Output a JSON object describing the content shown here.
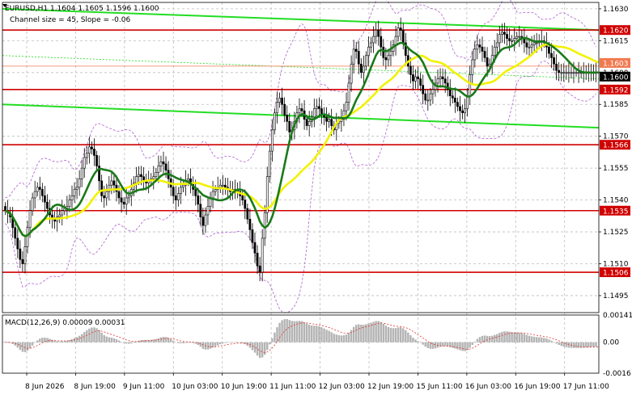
{
  "chart_data": {
    "type": "candlestick",
    "title": "EURUSD,H1  1.1604 1.1605 1.1596 1.1600",
    "subtitle": "Channel size = 45, Slope = -0.06",
    "y_ticks": [
      "1.1630",
      "1.1615",
      "1.1600",
      "1.1585",
      "1.1570",
      "1.1555",
      "1.1540",
      "1.1525",
      "1.1510",
      "1.1495"
    ],
    "ylim": [
      1.1487,
      1.1633
    ],
    "x_ticks": [
      "8 Jun 2026",
      "8 Jun 19:00",
      "9 Jun 11:00",
      "10 Jun 03:00",
      "10 Jun 19:00",
      "11 Jun 11:00",
      "12 Jun 03:00",
      "12 Jun 19:00",
      "15 Jun 11:00",
      "16 Jun 03:00",
      "16 Jun 19:00",
      "17 Jun 11:00"
    ],
    "bars_count": 240,
    "levels": [
      {
        "value": 1.162,
        "label": "1.1620",
        "color": "#d00000"
      },
      {
        "value": 1.1592,
        "label": "1.1592",
        "color": "#d00000"
      },
      {
        "value": 1.1566,
        "label": "1.1566",
        "color": "#d00000"
      },
      {
        "value": 1.1535,
        "label": "1.1535",
        "color": "#d00000"
      },
      {
        "value": 1.1506,
        "label": "1.1506",
        "color": "#d00000"
      }
    ],
    "price_labels": [
      {
        "value": 1.1603,
        "label": "1.1603",
        "color": "#f07a50"
      },
      {
        "value": 1.16,
        "label": "1.1600",
        "color": "#000000"
      }
    ],
    "channel_color": "#22dd22",
    "ma_fast_color": "#1a7a1a",
    "ma_slow_color": "#f2f200",
    "bollinger_color": "#b060d0",
    "close": [
      1.1535,
      1.1534,
      1.1532,
      1.1527,
      1.1522,
      1.1517,
      1.1512,
      1.151,
      1.1518,
      1.1527,
      1.1535,
      1.1541,
      1.1544,
      1.1546,
      1.1545,
      1.1542,
      1.1539,
      1.1536,
      1.1533,
      1.1531,
      1.153,
      1.1532,
      1.1533,
      1.1535,
      1.1536,
      1.1537,
      1.154,
      1.1542,
      1.1545,
      1.1546,
      1.155,
      1.1555,
      1.156,
      1.1562,
      1.1565,
      1.1564,
      1.1561,
      1.1556,
      1.1549,
      1.1542,
      1.1541,
      1.1544,
      1.1547,
      1.1549,
      1.1547,
      1.1544,
      1.1541,
      1.1539,
      1.1538,
      1.1541,
      1.1542,
      1.1545,
      1.1548,
      1.1551,
      1.1552,
      1.1551,
      1.1549,
      1.1548,
      1.1549,
      1.155,
      1.1551,
      1.1553,
      1.1556,
      1.1558,
      1.1557,
      1.1554,
      1.155,
      1.1546,
      1.1542,
      1.154,
      1.1543,
      1.1546,
      1.1547,
      1.1549,
      1.155,
      1.1548,
      1.1545,
      1.1542,
      1.1538,
      1.1532,
      1.1528,
      1.1533,
      1.1537,
      1.1541,
      1.1544,
      1.1545,
      1.1546,
      1.1547,
      1.1547,
      1.1546,
      1.1545,
      1.1544,
      1.1545,
      1.1545,
      1.1544,
      1.1542,
      1.154,
      1.1536,
      1.1531,
      1.1526,
      1.152,
      1.1515,
      1.1509,
      1.1506,
      1.1522,
      1.1534,
      1.1551,
      1.1563,
      1.1573,
      1.1581,
      1.1586,
      1.1588,
      1.1585,
      1.158,
      1.1577,
      1.1572,
      1.1573,
      1.1577,
      1.1581,
      1.1583,
      1.1582,
      1.1578,
      1.1575,
      1.1577,
      1.1579,
      1.1583,
      1.1584,
      1.1583,
      1.158,
      1.1579,
      1.1577,
      1.1578,
      1.1575,
      1.1573,
      1.1576,
      1.1577,
      1.1578,
      1.1582,
      1.1586,
      1.1595,
      1.1604,
      1.1611,
      1.161,
      1.1604,
      1.16,
      1.1603,
      1.1608,
      1.1612,
      1.1614,
      1.1617,
      1.162,
      1.1617,
      1.1612,
      1.1607,
      1.1606,
      1.1608,
      1.161,
      1.1613,
      1.1617,
      1.1621,
      1.162,
      1.1614,
      1.1608,
      1.1603,
      1.1599,
      1.1596,
      1.1598,
      1.1597,
      1.1594,
      1.159,
      1.1587,
      1.1587,
      1.159,
      1.1592,
      1.1595,
      1.1597,
      1.1598,
      1.1597,
      1.1595,
      1.1592,
      1.1589,
      1.1588,
      1.1586,
      1.1584,
      1.1582,
      1.1581,
      1.1583,
      1.1589,
      1.1599,
      1.1606,
      1.1611,
      1.1613,
      1.1612,
      1.161,
      1.1607,
      1.1603,
      1.1604,
      1.1608,
      1.1612,
      1.1614,
      1.1618,
      1.1619,
      1.1618,
      1.1616,
      1.1615,
      1.1615,
      1.1616,
      1.1617,
      1.1617,
      1.1616,
      1.1614,
      1.1612,
      1.1612,
      1.1613,
      1.1614,
      1.1614,
      1.1615,
      1.1615,
      1.1614,
      1.1612,
      1.1609,
      1.1607,
      1.1604,
      1.1601,
      1.16,
      1.16,
      1.16,
      1.16,
      1.16,
      1.16,
      1.16,
      1.16,
      1.16,
      1.16,
      1.16,
      1.16,
      1.16,
      1.16,
      1.16,
      1.16,
      1.16
    ],
    "macd": {
      "label": "MACD(12,26,9) 0.00009 0.00031",
      "y_ticks": [
        "0.00141",
        "0.00",
        "-0.0016"
      ],
      "ylim": [
        -0.0016,
        0.00141
      ]
    }
  }
}
